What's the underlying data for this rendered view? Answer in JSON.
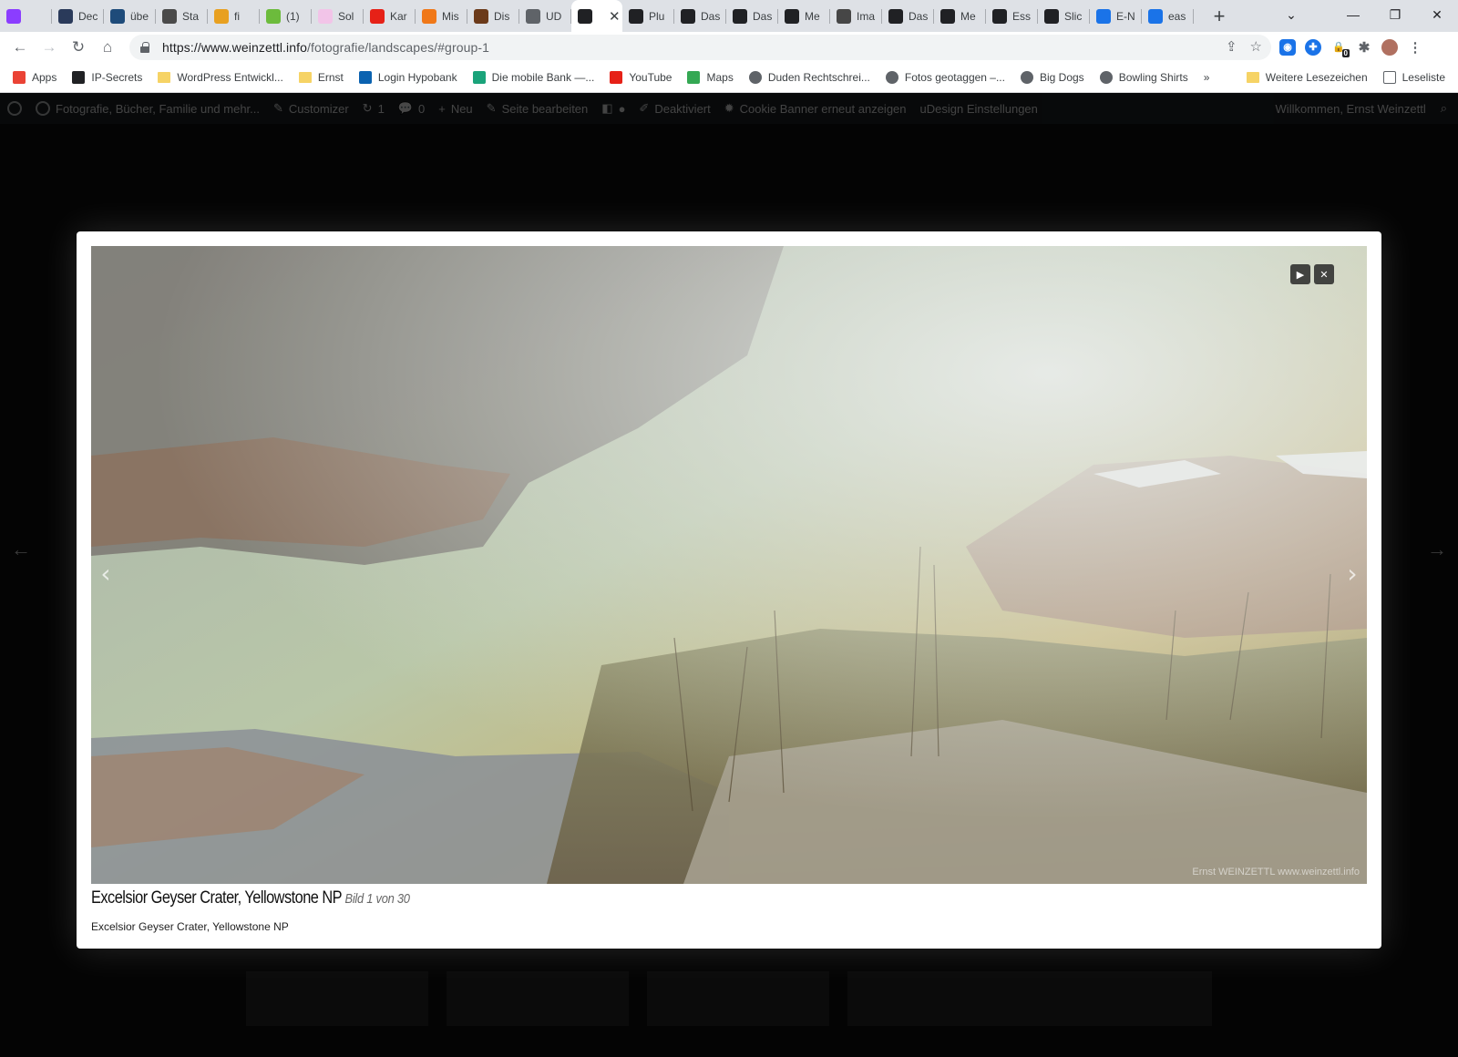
{
  "browser": {
    "tabs": [
      {
        "label": "",
        "icon": "proton-icon",
        "color": "#8b3dff"
      },
      {
        "label": "Dec",
        "icon": "shield-icon",
        "color": "#2a3a5a"
      },
      {
        "label": "übe",
        "icon": "l-icon",
        "color": "#1e4b7a"
      },
      {
        "label": "Sta",
        "icon": "search-icon",
        "color": "#4a4a4a"
      },
      {
        "label": "fi",
        "icon": "orange-box-icon",
        "color": "#e8a020"
      },
      {
        "label": "(1)",
        "icon": "green-leaf-icon",
        "color": "#6cbb3c"
      },
      {
        "label": "Sol",
        "icon": "pink-icon",
        "color": "#f2c4e8"
      },
      {
        "label": "Kar",
        "icon": "youtube-icon",
        "color": "#e62117"
      },
      {
        "label": "Mis",
        "icon": "photo-icon",
        "color": "#f07818"
      },
      {
        "label": "Dis",
        "icon": "book-icon",
        "color": "#6b3a1a"
      },
      {
        "label": "UD",
        "icon": "globe-icon",
        "color": "#5f6368"
      },
      {
        "label": "",
        "icon": "eye-icon",
        "color": "#202124",
        "active": true
      },
      {
        "label": "Plu",
        "icon": "eye-icon",
        "color": "#202124"
      },
      {
        "label": "Das",
        "icon": "eye-icon",
        "color": "#202124"
      },
      {
        "label": "Das",
        "icon": "eye-icon",
        "color": "#202124"
      },
      {
        "label": "Me",
        "icon": "github-icon",
        "color": "#202124"
      },
      {
        "label": "Ima",
        "icon": "wordpress-icon",
        "color": "#464646"
      },
      {
        "label": "Das",
        "icon": "eye-icon",
        "color": "#202124"
      },
      {
        "label": "Me",
        "icon": "eye-icon",
        "color": "#202124"
      },
      {
        "label": "Ess",
        "icon": "eye-icon",
        "color": "#202124"
      },
      {
        "label": "Slic",
        "icon": "eye-icon",
        "color": "#202124"
      },
      {
        "label": "E-N",
        "icon": "en-icon",
        "color": "#1a73e8"
      },
      {
        "label": "eas",
        "icon": "en-icon",
        "color": "#1a73e8"
      }
    ],
    "url_host": "https://www.weinzettl.info",
    "url_path": "/fotografie/landscapes/#group-1",
    "bookmarks": [
      {
        "label": "Apps",
        "icon": "apps-grid-icon"
      },
      {
        "label": "IP-Secrets",
        "icon": "ip-icon"
      },
      {
        "label": "WordPress Entwickl...",
        "icon": "folder-icon"
      },
      {
        "label": "Ernst",
        "icon": "folder-icon"
      },
      {
        "label": "Login Hypobank",
        "icon": "hypo-icon"
      },
      {
        "label": "Die mobile Bank —...",
        "icon": "n-icon"
      },
      {
        "label": "YouTube",
        "icon": "youtube-icon"
      },
      {
        "label": "Maps",
        "icon": "maps-pin-icon"
      },
      {
        "label": "Duden Rechtschrei...",
        "icon": "globe-icon"
      },
      {
        "label": "Fotos geotaggen –...",
        "icon": "globe-icon"
      },
      {
        "label": "Big Dogs",
        "icon": "globe-icon"
      },
      {
        "label": "Bowling Shirts",
        "icon": "globe-icon"
      }
    ],
    "bookmarks_more": "»",
    "bookmarks_other": "Weitere Lesezeichen",
    "reading_list": "Leseliste",
    "ext_badge": "0"
  },
  "wpbar": {
    "site": "Fotografie, Bücher, Familie und mehr...",
    "customizer": "Customizer",
    "updates": "1",
    "comments": "0",
    "new": "Neu",
    "edit": "Seite bearbeiten",
    "deactivated": "Deaktiviert",
    "cookie": "Cookie Banner erneut anzeigen",
    "udesign": "uDesign Einstellungen",
    "welcome": "Willkommen, Ernst Weinzettl"
  },
  "lightbox": {
    "title": "Excelsior Geyser Crater, Yellowstone NP",
    "counter": "Bild 1 von 30",
    "description": "Excelsior Geyser Crater, Yellowstone NP",
    "watermark": "Ernst WEINZETTL www.weinzettl.info",
    "play_glyph": "▶",
    "close_glyph": "✕",
    "prev_glyph": "‹",
    "next_glyph": "›"
  },
  "page": {
    "prev_arrow": "←",
    "next_arrow": "→"
  }
}
